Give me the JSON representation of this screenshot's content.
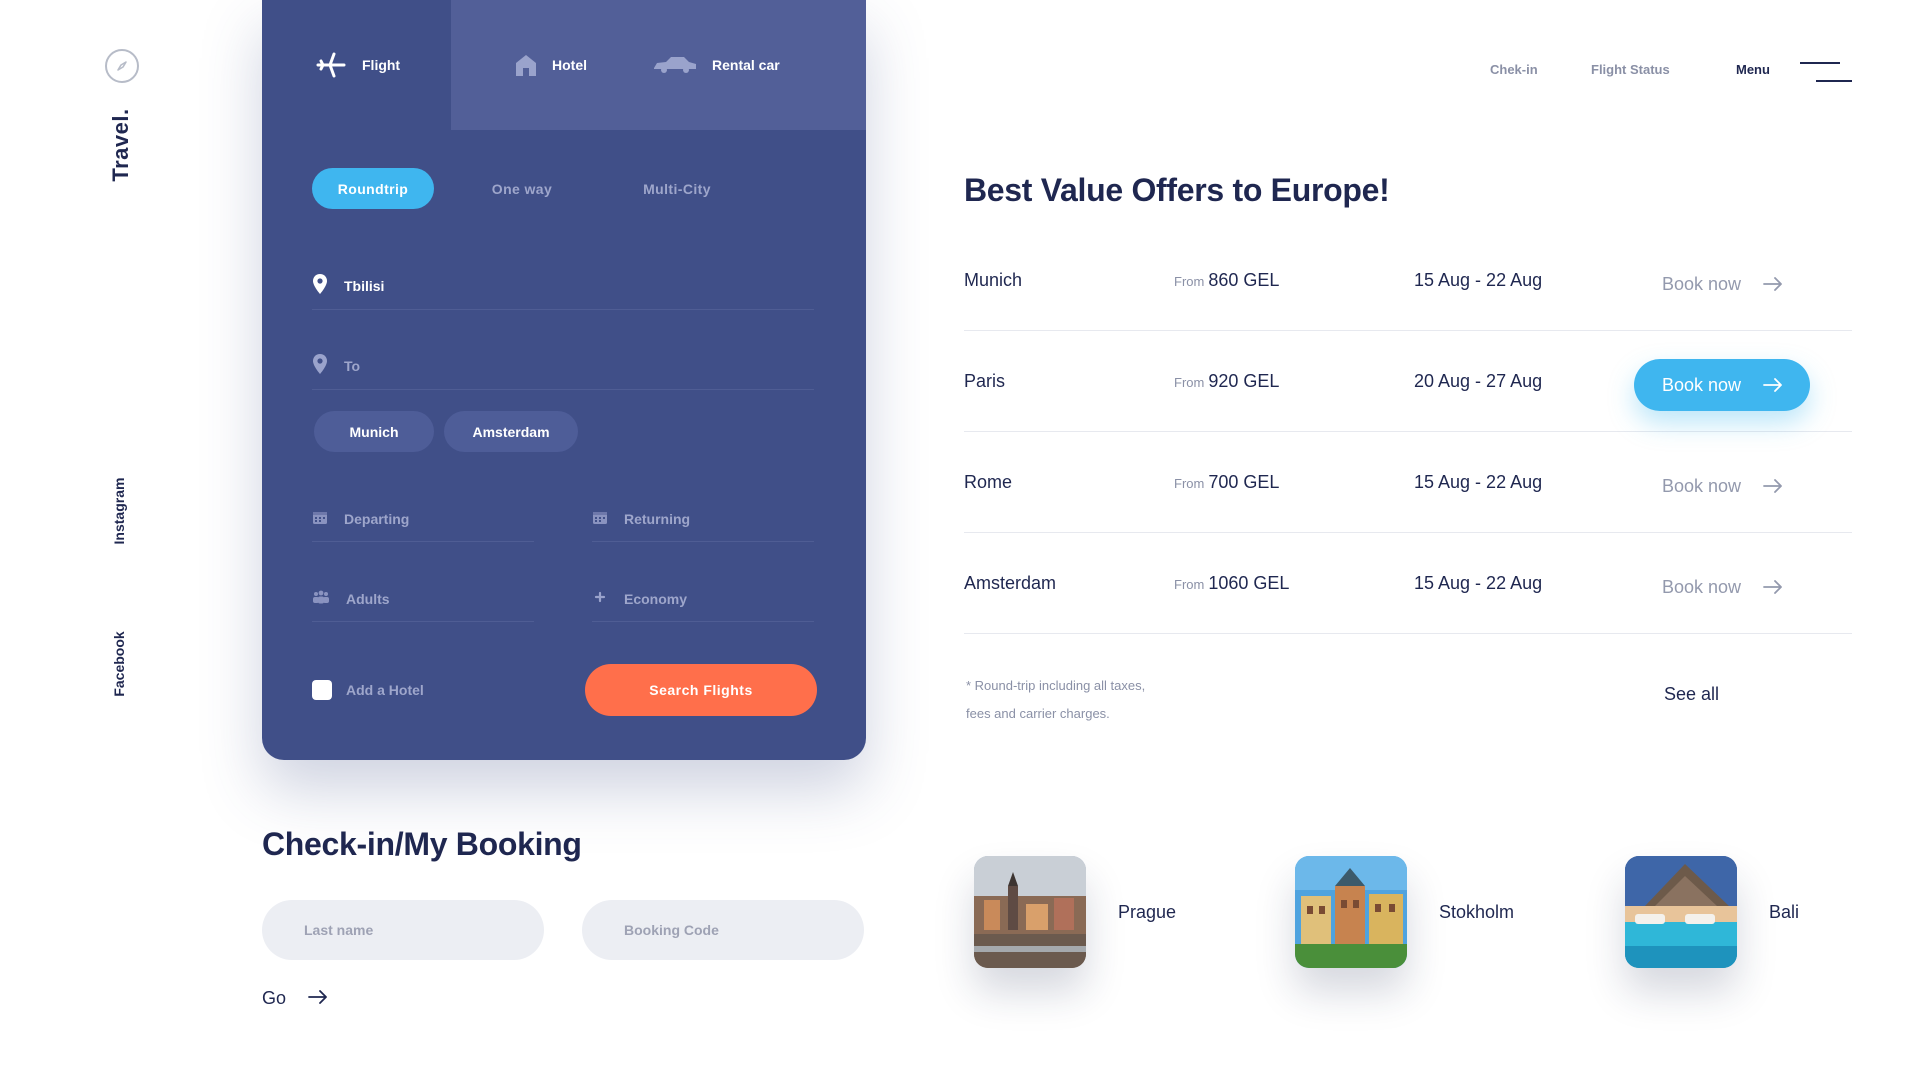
{
  "brand": {
    "name": "Travel.",
    "logo_icon": "compass-icon"
  },
  "social": {
    "instagram": "Instagram",
    "facebook": "Facebook"
  },
  "nav": {
    "checkin": "Chek-in",
    "flight_status": "Flight Status",
    "menu": "Menu"
  },
  "booking": {
    "tabs": [
      {
        "label": "Flight",
        "icon": "plane-icon",
        "active": true
      },
      {
        "label": "Hotel",
        "icon": "house-icon",
        "active": false
      },
      {
        "label": "Rental car",
        "icon": "car-icon",
        "active": false
      }
    ],
    "trip_types": [
      {
        "label": "Roundtrip",
        "active": true
      },
      {
        "label": "One way",
        "active": false
      },
      {
        "label": "Multi-City",
        "active": false
      }
    ],
    "from_value": "Tbilisi",
    "to_placeholder": "To",
    "suggestions": [
      "Munich",
      "Amsterdam"
    ],
    "departing_placeholder": "Departing",
    "returning_placeholder": "Returning",
    "adults_placeholder": "Adults",
    "class_value": "Economy",
    "add_hotel": "Add a Hotel",
    "search_button": "Search Flights"
  },
  "offers": {
    "title": "Best Value Offers to Europe!",
    "from_label": "From",
    "book_label": "Book now",
    "rows": [
      {
        "city": "Munich",
        "price": "860 GEL",
        "dates": "15 Aug - 22 Aug"
      },
      {
        "city": "Paris",
        "price": "920 GEL",
        "dates": "20 Aug - 27 Aug"
      },
      {
        "city": "Rome",
        "price": "700 GEL",
        "dates": "15 Aug - 22 Aug"
      },
      {
        "city": "Amsterdam",
        "price": "1060 GEL",
        "dates": "15 Aug - 22 Aug"
      }
    ],
    "highlighted_row": 2,
    "note_line1": "* Round-trip including all taxes,",
    "note_line2": "fees and carrier charges.",
    "see_all": "See all"
  },
  "checkin": {
    "title": "Check-in/My Booking",
    "last_name_placeholder": "Last name",
    "booking_code_placeholder": "Booking Code",
    "go": "Go"
  },
  "destinations": [
    "Prague",
    "Stokholm",
    "Bali"
  ],
  "colors": {
    "card": "#404f88",
    "card_tab_inactive": "#525f98",
    "accent_blue": "#3fb6ef",
    "accent_orange": "#ff6f4b",
    "text_dark": "#1f2750",
    "text_muted": "#8a90a6"
  }
}
